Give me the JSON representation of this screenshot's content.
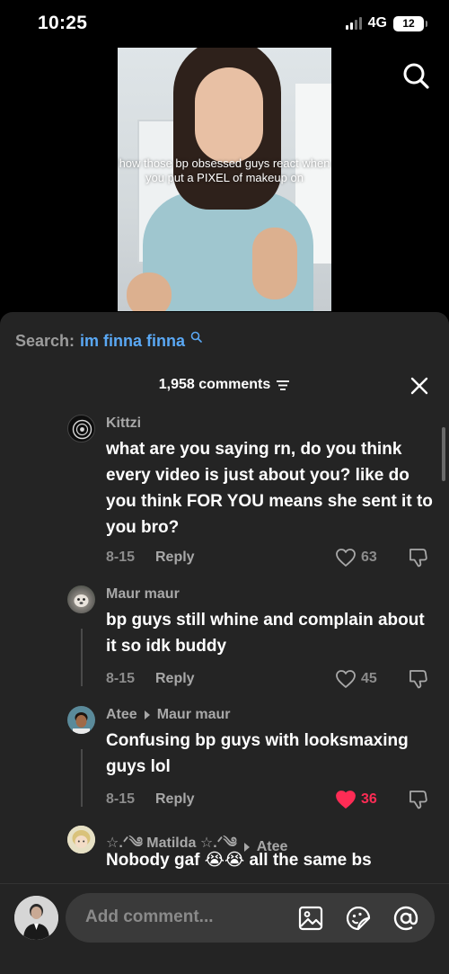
{
  "status_bar": {
    "time": "10:25",
    "network": "4G",
    "battery": "12"
  },
  "video": {
    "caption": "how those bp obsessed guys react when you put a PIXEL of makeup on"
  },
  "search_suggestion": {
    "prefix": "Search:",
    "term": "im finna finna"
  },
  "comments_header": {
    "count_label": "1,958 comments"
  },
  "comments": [
    {
      "username": "Kittzi",
      "reply_to": "",
      "text": "what are you saying rn, do you think every video is just about you? like do you think FOR YOU means she sent it to you bro?",
      "date": "8-15",
      "reply_label": "Reply",
      "likes": "63",
      "liked": false
    },
    {
      "username": "Maur maur",
      "reply_to": "",
      "text": "bp guys still whine and complain about it so idk buddy",
      "date": "8-15",
      "reply_label": "Reply",
      "likes": "45",
      "liked": false
    },
    {
      "username": "Atee",
      "reply_to": "Maur maur",
      "text": "Confusing bp guys with looksmaxing guys lol",
      "date": "8-15",
      "reply_label": "Reply",
      "likes": "36",
      "liked": true
    },
    {
      "username": "☆.ᐟ༄ Matilda ☆.ᐟ༄",
      "reply_to": "Atee",
      "text": "Nobody gaf 😭😭 all the same bs",
      "date": "",
      "reply_label": "",
      "likes": "",
      "liked": false
    }
  ],
  "composer": {
    "placeholder": "Add comment..."
  },
  "colors": {
    "sheet_bg": "#242424",
    "accent_link": "#5aa8f4",
    "like_red": "#fe2c55"
  },
  "icons": [
    "search-icon",
    "filter-icon",
    "close-icon",
    "heart-icon",
    "dislike-icon",
    "image-icon",
    "emoji-sticker-icon",
    "mention-icon"
  ]
}
